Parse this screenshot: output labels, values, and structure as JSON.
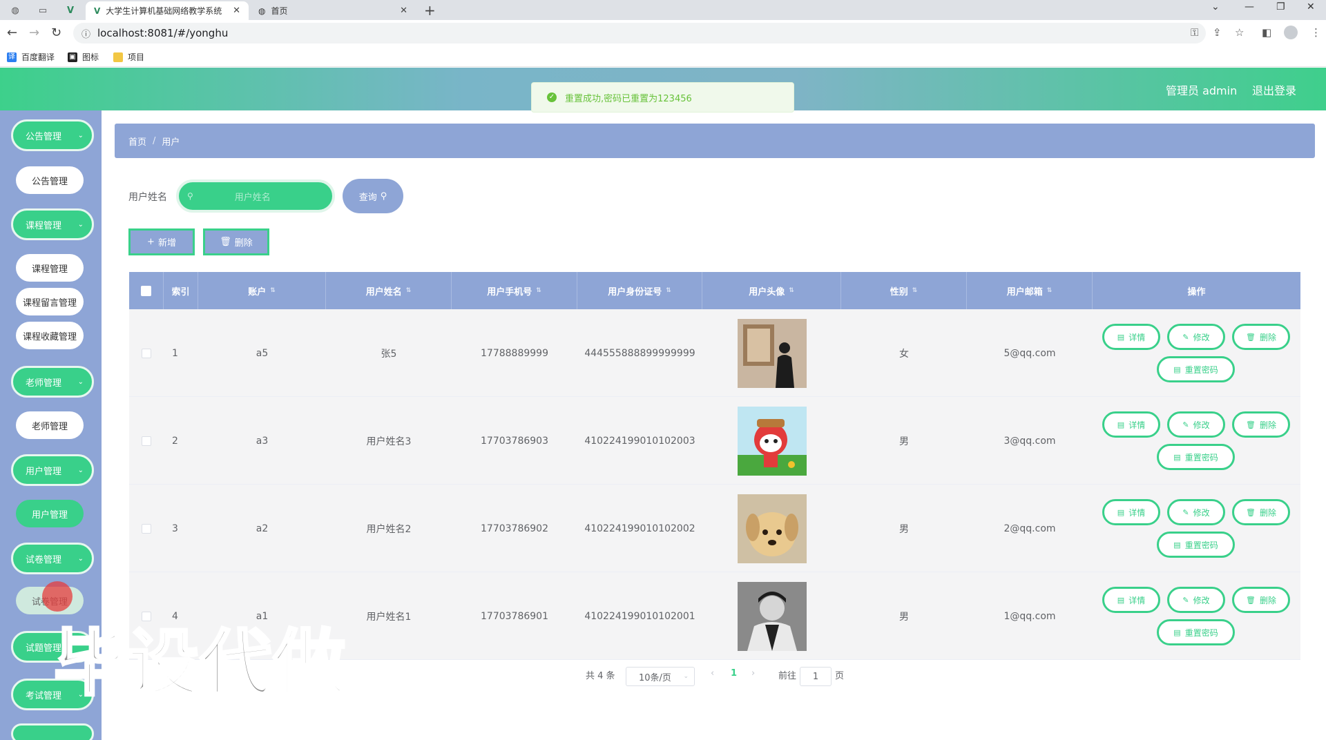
{
  "browser": {
    "tabs": [
      {
        "title": "大学生计算机基础网络教学系统",
        "active": true
      },
      {
        "title": "首页",
        "active": false
      }
    ],
    "url": "localhost:8081/#/yonghu",
    "bookmarks": [
      "百度翻译",
      "图标",
      "项目"
    ]
  },
  "header": {
    "user_label": "管理员 admin",
    "logout_label": "退出登录"
  },
  "toast": {
    "message": "重置成功,密码已重置为123456",
    "type": "success"
  },
  "sidebar": {
    "groups": [
      {
        "label": "公告管理",
        "items": [
          "公告管理"
        ]
      },
      {
        "label": "课程管理",
        "items": [
          "课程管理",
          "课程留言管理",
          "课程收藏管理"
        ]
      },
      {
        "label": "老师管理",
        "items": [
          "老师管理"
        ]
      },
      {
        "label": "用户管理",
        "items": [
          "用户管理"
        ]
      },
      {
        "label": "试卷管理",
        "items": [
          "试卷管理"
        ]
      },
      {
        "label": "试题管理",
        "items": []
      },
      {
        "label": "考试管理",
        "items": []
      }
    ],
    "active_item": "用户管理"
  },
  "breadcrumb": [
    "首页",
    "用户"
  ],
  "search": {
    "label": "用户姓名",
    "placeholder": "用户姓名",
    "button": "查询"
  },
  "actions": {
    "add": "新增",
    "delete": "删除"
  },
  "table": {
    "columns": [
      "索引",
      "账户",
      "用户姓名",
      "用户手机号",
      "用户身份证号",
      "用户头像",
      "性别",
      "用户邮箱",
      "操作"
    ],
    "rows": [
      {
        "index": "1",
        "account": "a5",
        "name": "张5",
        "phone": "17788889999",
        "id_card": "444555888899999999",
        "gender": "女",
        "email": "5@qq.com"
      },
      {
        "index": "2",
        "account": "a3",
        "name": "用户姓名3",
        "phone": "17703786903",
        "id_card": "410224199010102003",
        "gender": "男",
        "email": "3@qq.com"
      },
      {
        "index": "3",
        "account": "a2",
        "name": "用户姓名2",
        "phone": "17703786902",
        "id_card": "410224199010102002",
        "gender": "男",
        "email": "2@qq.com"
      },
      {
        "index": "4",
        "account": "a1",
        "name": "用户姓名1",
        "phone": "17703786901",
        "id_card": "410224199010102001",
        "gender": "男",
        "email": "1@qq.com"
      }
    ],
    "row_actions": {
      "detail": "详情",
      "edit": "修改",
      "delete": "删除",
      "reset": "重置密码"
    }
  },
  "pagination": {
    "total": "共 4 条",
    "page_size": "10条/页",
    "current": "1",
    "goto_prefix": "前往",
    "goto_value": "1",
    "goto_suffix": "页"
  },
  "watermark": "毕设代做",
  "colors": {
    "accent_green": "#39d08a",
    "accent_blue": "#8ea5d6",
    "success": "#67c23a"
  }
}
